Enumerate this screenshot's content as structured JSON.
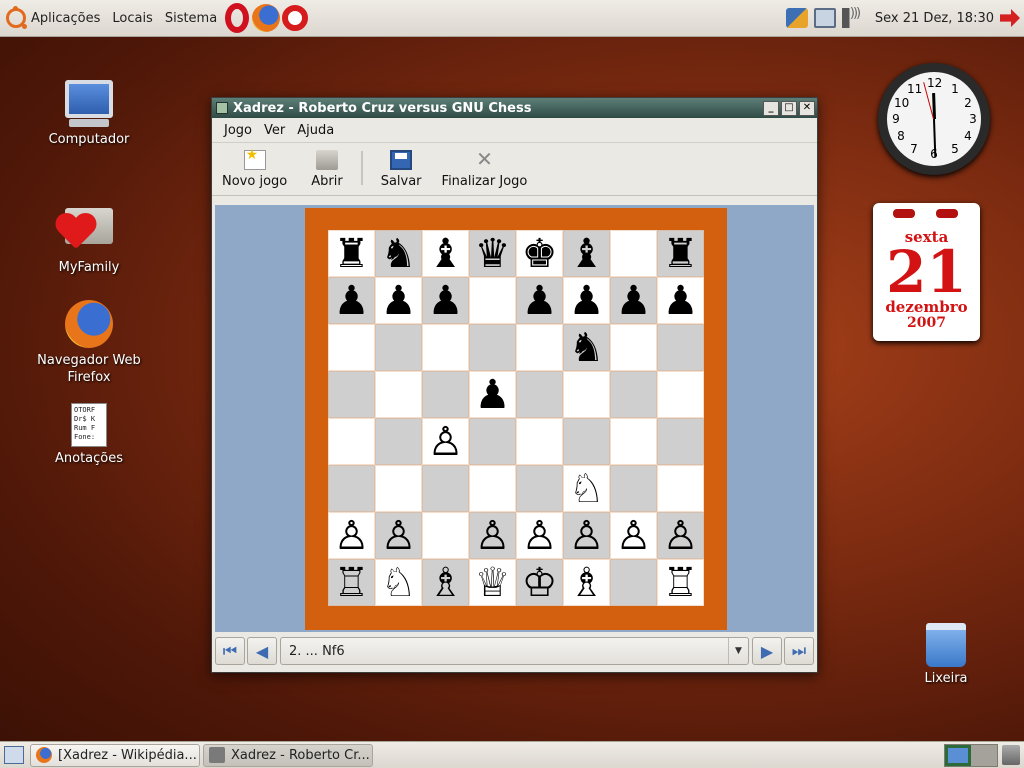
{
  "top_panel": {
    "menus": [
      "Aplicações",
      "Locais",
      "Sistema"
    ],
    "clock": "Sex 21 Dez, 18:30"
  },
  "desktop_icons": [
    {
      "label": "Computador",
      "icon": "computer-icon"
    },
    {
      "label": "MyFamily",
      "icon": "heart-folder-icon"
    },
    {
      "label": "Navegador Web Firefox",
      "icon": "firefox-icon"
    },
    {
      "label": "Anotações",
      "icon": "notes-file-icon",
      "preview_lines": [
        "OTORF",
        "Dr$ K",
        "Rum F",
        "Fone:"
      ]
    },
    {
      "label": "Lixeira",
      "icon": "trash-icon"
    }
  ],
  "clock_widget": {
    "numbers": [
      "12",
      "1",
      "2",
      "3",
      "4",
      "5",
      "6",
      "7",
      "8",
      "9",
      "10",
      "11"
    ],
    "time": "18:30"
  },
  "calendar_widget": {
    "weekday": "sexta",
    "day": "21",
    "month": "dezembro",
    "year": "2007"
  },
  "chess_window": {
    "title": "Xadrez - Roberto Cruz versus GNU Chess",
    "menus": [
      "Jogo",
      "Ver",
      "Ajuda"
    ],
    "toolbar": {
      "new_game": "Novo jogo",
      "open": "Abrir",
      "save": "Salvar",
      "end_game": "Finalizar Jogo"
    },
    "board": [
      [
        "♜",
        "♞",
        "♝",
        "♛",
        "♚",
        "♝",
        "",
        "♜"
      ],
      [
        "♟",
        "♟",
        "♟",
        "",
        "♟",
        "♟",
        "♟",
        "♟"
      ],
      [
        "",
        "",
        "",
        "",
        "",
        "♞",
        "",
        ""
      ],
      [
        "",
        "",
        "",
        "♟",
        "",
        "",
        "",
        ""
      ],
      [
        "",
        "",
        "♙",
        "",
        "",
        "",
        "",
        ""
      ],
      [
        "",
        "",
        "",
        "",
        "",
        "♘",
        "",
        ""
      ],
      [
        "♙",
        "♙",
        "",
        "♙",
        "♙",
        "♙",
        "♙",
        "♙"
      ],
      [
        "♖",
        "♘",
        "♗",
        "♕",
        "♔",
        "♗",
        "",
        "♖"
      ]
    ],
    "current_move": "2. ... Nf6",
    "colors": {
      "frame": "#d2600e",
      "light_square": "#ffffff",
      "dark_square": "#cfcfcf",
      "background": "#8fa8c8"
    }
  },
  "taskbar": {
    "tasks": [
      {
        "label": "[Xadrez - Wikipédia...",
        "icon": "firefox-icon"
      },
      {
        "label": "Xadrez - Roberto Cr...",
        "icon": "chess-icon"
      }
    ]
  }
}
